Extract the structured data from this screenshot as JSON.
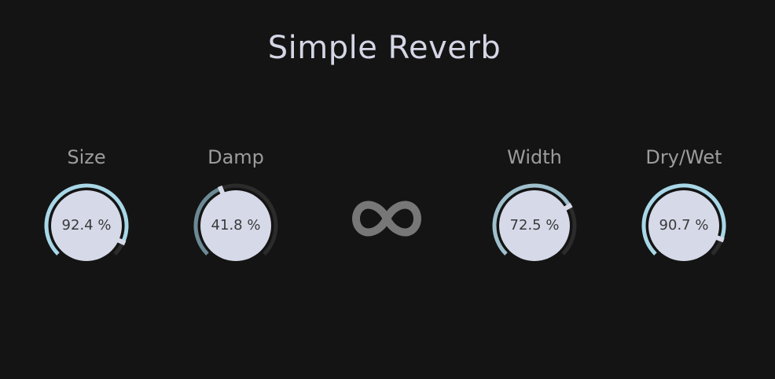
{
  "title": "Simple Reverb",
  "colors": {
    "background": "#141414",
    "track": "#2b2b2b",
    "knob_face": "#d6d9e8",
    "link_icon": "#777777"
  },
  "link_toggle": {
    "icon": "infinity-icon"
  },
  "knobs": [
    {
      "id": "size",
      "label": "Size",
      "value_text": "92.4 %",
      "value": 0.924,
      "accent": "#a8d8e8"
    },
    {
      "id": "damp",
      "label": "Damp",
      "value_text": "41.8 %",
      "value": 0.418,
      "accent": "#6b8a96"
    },
    {
      "id": "width",
      "label": "Width",
      "value_text": "72.5 %",
      "value": 0.725,
      "accent": "#9ec0cc"
    },
    {
      "id": "drywet",
      "label": "Dry/Wet",
      "value_text": "90.7 %",
      "value": 0.907,
      "accent": "#a8d8e8"
    }
  ]
}
